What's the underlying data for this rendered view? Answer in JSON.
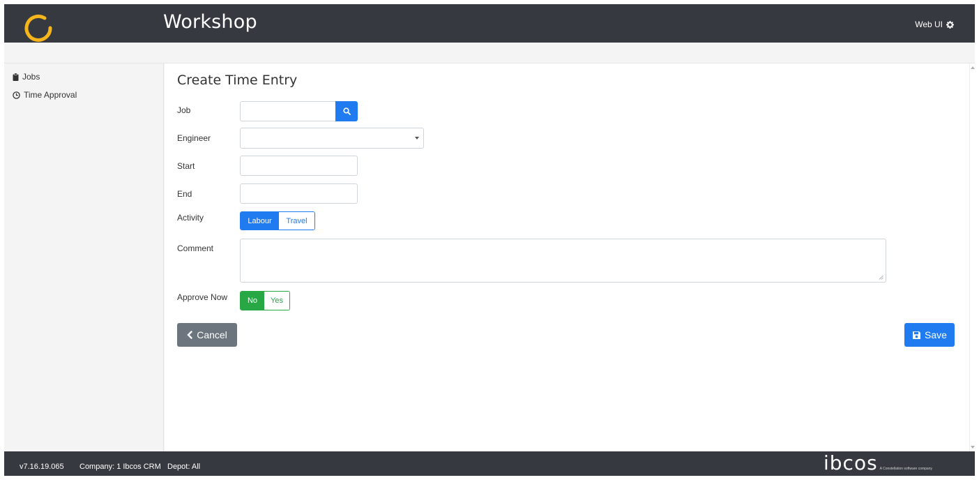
{
  "header": {
    "app_title": "Workshop",
    "webui_label": "Web UI",
    "logo_color": "#f5b51b"
  },
  "sidebar": {
    "items": [
      {
        "label": "Jobs",
        "icon": "clipboard-icon"
      },
      {
        "label": "Time Approval",
        "icon": "clock-icon"
      }
    ]
  },
  "form": {
    "title": "Create Time Entry",
    "job_label": "Job",
    "job_value": "",
    "engineer_label": "Engineer",
    "engineer_value": "",
    "start_label": "Start",
    "start_value": "",
    "end_label": "End",
    "end_value": "",
    "activity_label": "Activity",
    "activity_options": [
      "Labour",
      "Travel"
    ],
    "activity_selected": "Labour",
    "comment_label": "Comment",
    "comment_value": "",
    "approve_label": "Approve Now",
    "approve_options": [
      "No",
      "Yes"
    ],
    "approve_selected": "No"
  },
  "actions": {
    "cancel_label": "Cancel",
    "save_label": "Save"
  },
  "footer": {
    "version": "v7.16.19.065",
    "company": "Company: 1 Ibcos CRM",
    "depot": "Depot: All",
    "brand": "ibcos",
    "brand_tagline": "A Constellation software company"
  },
  "colors": {
    "primary": "#1f7bef",
    "success": "#28a745",
    "secondary": "#6c757d",
    "header_bg": "#363a40"
  }
}
